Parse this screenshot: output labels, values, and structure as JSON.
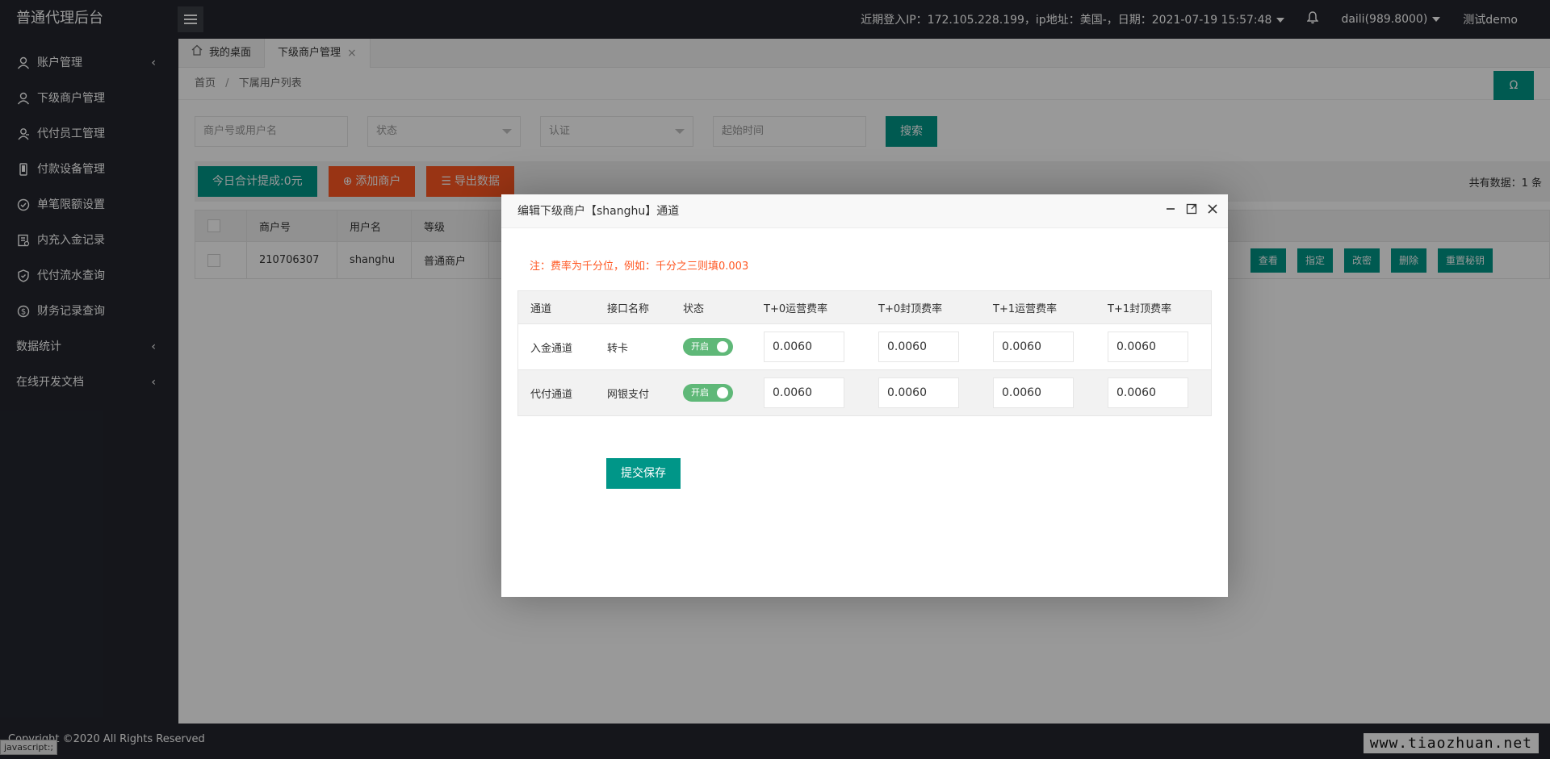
{
  "app": {
    "title": "普通代理后台"
  },
  "topbar": {
    "login_info": "近期登入IP：172.105.228.199，ip地址：美国-，日期：2021-07-19 15:57:48",
    "user": "daili(989.8000)",
    "demo": "测试demo"
  },
  "sidebar": {
    "items": [
      {
        "label": "账户管理",
        "icon": "user-icon"
      },
      {
        "label": "下级商户管理",
        "icon": "user-icon"
      },
      {
        "label": "代付员工管理",
        "icon": "users-icon"
      },
      {
        "label": "付款设备管理",
        "icon": "phone-icon"
      },
      {
        "label": "单笔限额设置",
        "icon": "check-circle-icon"
      },
      {
        "label": "内充入金记录",
        "icon": "receipt-icon"
      },
      {
        "label": "代付流水查询",
        "icon": "shield-icon"
      },
      {
        "label": "财务记录查询",
        "icon": "dollar-icon"
      },
      {
        "label": "数据统计",
        "icon": ""
      },
      {
        "label": "在线开发文档",
        "icon": ""
      }
    ]
  },
  "tabs": [
    {
      "label": "我的桌面"
    },
    {
      "label": "下级商户管理"
    }
  ],
  "breadcrumb": {
    "home": "首页",
    "sep": "/",
    "current": "下属用户列表"
  },
  "refresh_label": "Ω",
  "search": {
    "merchant_placeholder": "商户号或用户名",
    "status_placeholder": "状态",
    "auth_placeholder": "认证",
    "start_placeholder": "起始时间",
    "search_button": "搜索"
  },
  "toolbar": {
    "today_total": "今日合计提成:0元",
    "add_merchant": "添加商户",
    "export": "导出数据",
    "count": "共有数据：1 条"
  },
  "table": {
    "headers": [
      "商户号",
      "用户名",
      "等级"
    ],
    "rows": [
      {
        "id": "210706307",
        "username": "shanghu",
        "level": "普通商户"
      }
    ],
    "actions": [
      "查看",
      "指定",
      "改密",
      "删除",
      "重置秘钥"
    ]
  },
  "dialog": {
    "title": "编辑下级商户【shanghu】通道",
    "note": "注：费率为千分位，例如：千分之三则填0.003",
    "headers": [
      "通道",
      "接口名称",
      "状态",
      "T+0运营费率",
      "T+0封顶费率",
      "T+1运营费率",
      "T+1封顶费率"
    ],
    "rows": [
      {
        "channel": "入金通道",
        "api": "转卡",
        "status": "开启",
        "t0_op": "0.0060",
        "t0_cap": "0.0060",
        "t1_op": "0.0060",
        "t1_cap": "0.0060"
      },
      {
        "channel": "代付通道",
        "api": "网银支付",
        "status": "开启",
        "t0_op": "0.0060",
        "t0_cap": "0.0060",
        "t1_op": "0.0060",
        "t1_cap": "0.0060"
      }
    ],
    "save": "提交保存"
  },
  "footer": {
    "copyright": "Copyright ©2020 All Rights Reserved",
    "status": "javascript:;",
    "watermark": "www.tiaozhuan.net"
  }
}
